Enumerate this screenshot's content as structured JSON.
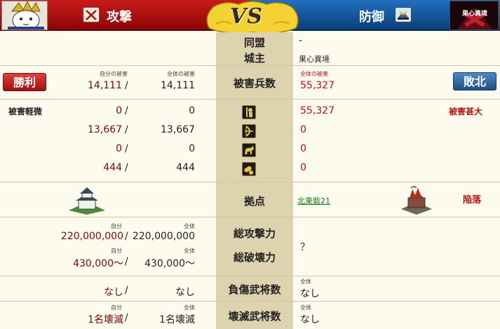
{
  "header": {
    "attacker_title": "攻撃",
    "defender_title": "防御",
    "vs_label": "VS",
    "defender_emblem_label": "果心異境"
  },
  "alliance": {
    "label": "同盟",
    "value": "-"
  },
  "lord": {
    "label": "城主",
    "value": "果心異境"
  },
  "casualties": {
    "label": "被害兵数",
    "result_attacker": "勝利",
    "result_defender": "敗北",
    "self_caption": "自分の被害",
    "all_caption": "全体の被害",
    "atk_self": "14,111",
    "atk_all": "14,111",
    "def_caption": "全体の被害",
    "def_all": "55,327"
  },
  "units": {
    "atk_status": "被害軽微",
    "def_status": "被害甚大",
    "rows": [
      {
        "icon": "spearman-icon",
        "atk_self": "0",
        "atk_all": "0",
        "def": "55,327"
      },
      {
        "icon": "archer-icon",
        "atk_self": "13,667",
        "atk_all": "13,667",
        "def": "0"
      },
      {
        "icon": "cavalry-icon",
        "atk_self": "0",
        "atk_all": "0",
        "def": "0"
      },
      {
        "icon": "siege-icon",
        "atk_self": "444",
        "atk_all": "444",
        "def": "0"
      }
    ]
  },
  "base": {
    "label": "拠点",
    "link": "北東砦21",
    "status": "陥落"
  },
  "power": {
    "attack_label": "総攻撃力",
    "destroy_label": "総破壊力",
    "self_caption": "自分",
    "all_caption": "全体",
    "atk_self": "220,000,000",
    "atk_all": "220,000,000",
    "destroy_self": "430,000〜",
    "destroy_all": "430,000〜",
    "def_value": "？"
  },
  "wounded": {
    "label": "負傷武将数",
    "self_caption": "自分",
    "all_caption": "全体",
    "atk_self": "なし",
    "atk_all": "なし",
    "def_caption": "全体",
    "def_all": "なし"
  },
  "destroyed": {
    "label": "壊滅武将数",
    "self_caption": "自分",
    "all_caption": "全体",
    "atk_self": "1名壊滅",
    "atk_all": "1名壊滅",
    "def_caption": "全体",
    "def_all": "なし"
  },
  "colors": {
    "attacker": "#c81b1b",
    "defender": "#1a5fa8",
    "win_button": "#c02020",
    "lose_button": "#2a5f96",
    "panel": "#fdfbee",
    "mid_column": "#ddd3ae"
  }
}
